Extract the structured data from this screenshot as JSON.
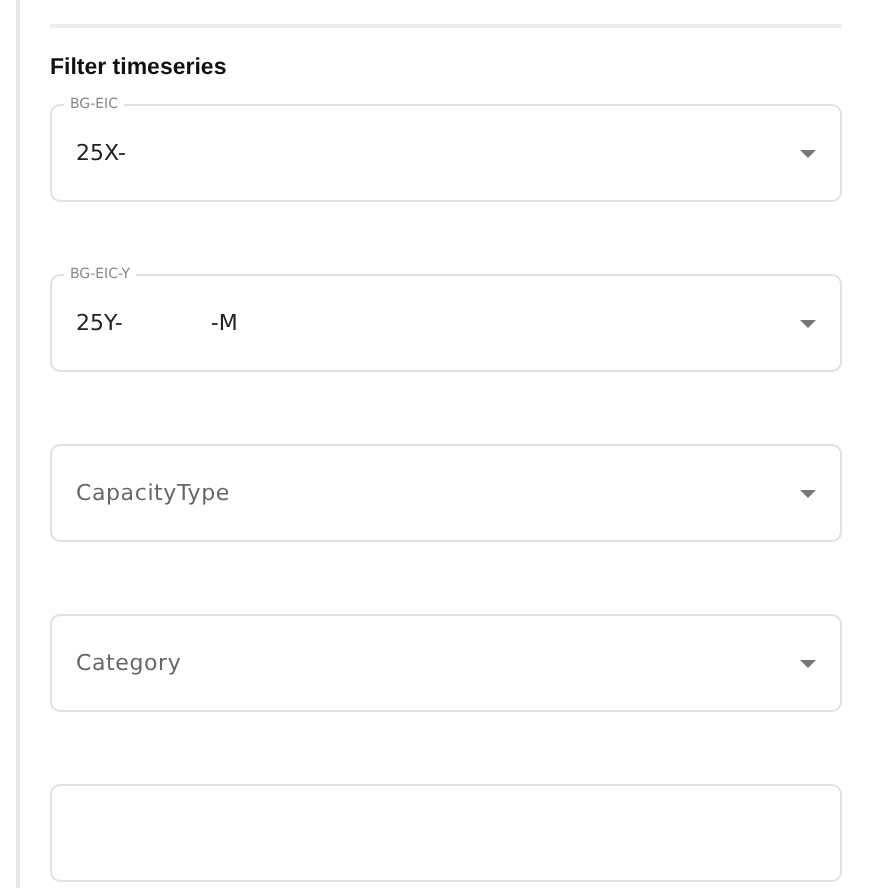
{
  "section_title": "Filter timeseries",
  "fields": [
    {
      "kind": "select",
      "label": "BG-EIC",
      "value_parts": [
        "25X-"
      ]
    },
    {
      "kind": "select",
      "label": "BG-EIC-Y",
      "value_parts": [
        "25Y-",
        "-M"
      ]
    },
    {
      "kind": "select",
      "placeholder": "CapacityType"
    },
    {
      "kind": "select",
      "placeholder": "Category"
    },
    {
      "kind": "select"
    }
  ]
}
